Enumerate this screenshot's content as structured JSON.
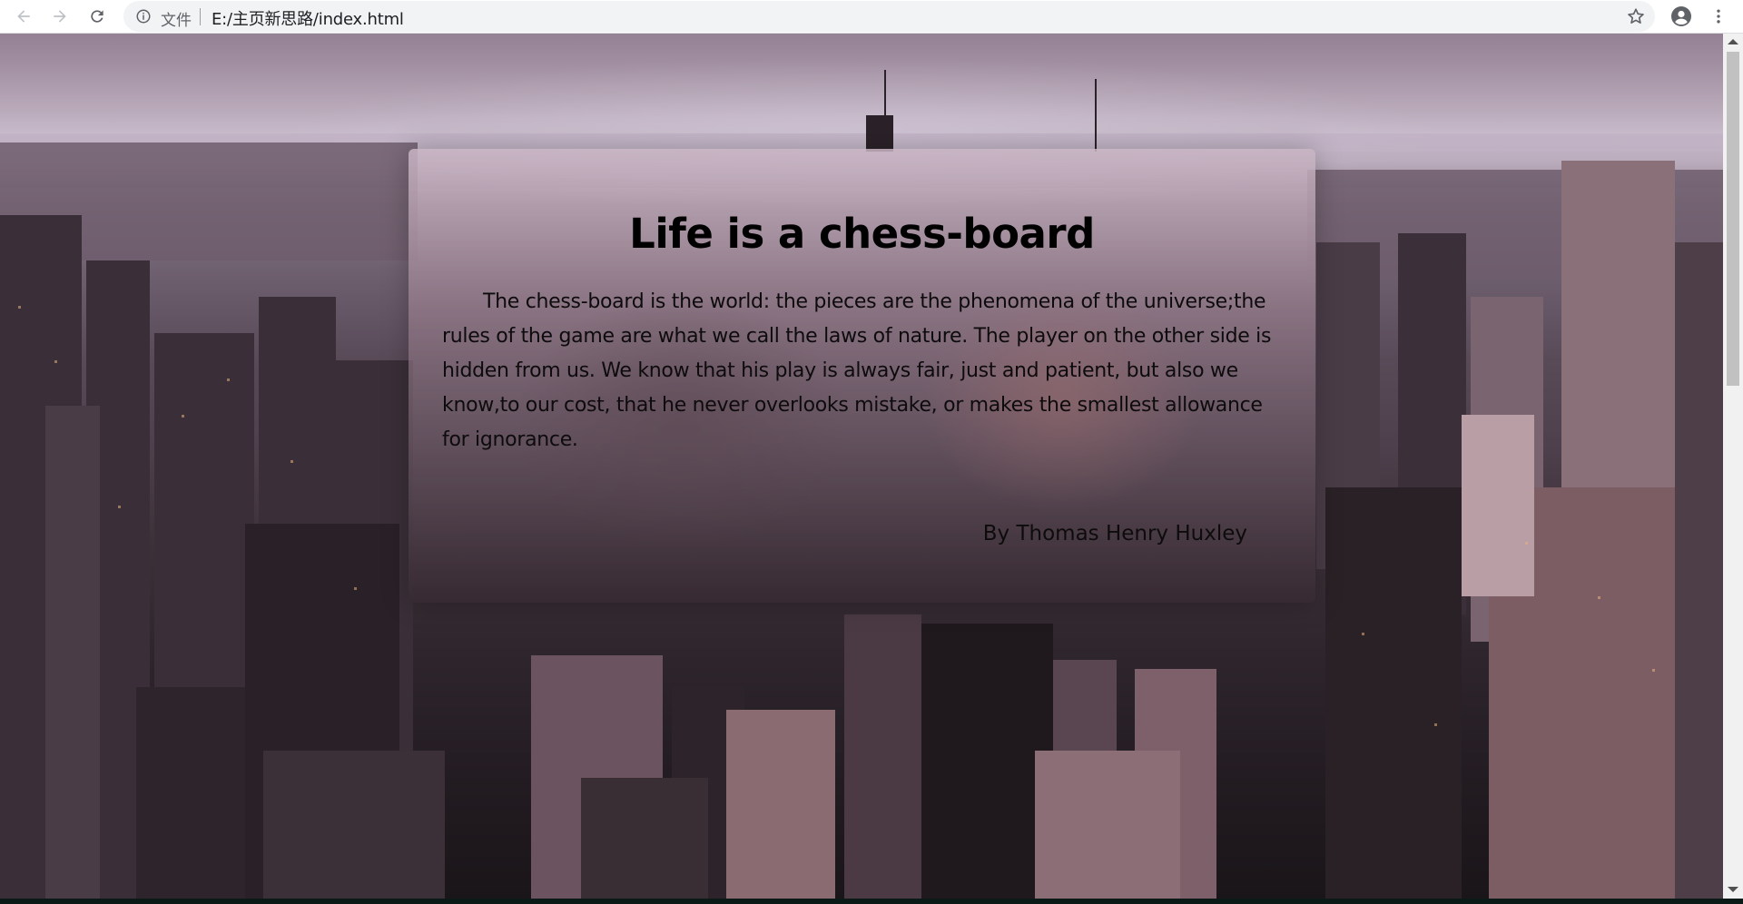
{
  "browser": {
    "back_icon": "arrow-left-icon",
    "forward_icon": "arrow-right-icon",
    "reload_icon": "reload-icon",
    "info_icon": "info-circle-icon",
    "scheme_label": "文件",
    "url": "E:/主页新思路/index.html",
    "bookmark_icon": "star-icon",
    "profile_icon": "account-circle-icon",
    "menu_icon": "vertical-dots-icon"
  },
  "page": {
    "title": "Life is a chess-board",
    "body": "The chess-board is the world: the pieces are the phenomena of the universe;the rules of the game are what we call the laws of nature. The player on the other side is hidden from us. We know that his play is always fair, just and patient, but also we know,to our cost, that he never overlooks mistake, or makes the smallest allowance for ignorance.",
    "author": "By Thomas Henry Huxley"
  },
  "colors": {
    "toolbar_bg": "#ffffff",
    "omnibox_bg": "#f1f3f4",
    "text_dark": "#000000",
    "sky_pink": "#c9bccb",
    "city_dark": "#241d23"
  }
}
